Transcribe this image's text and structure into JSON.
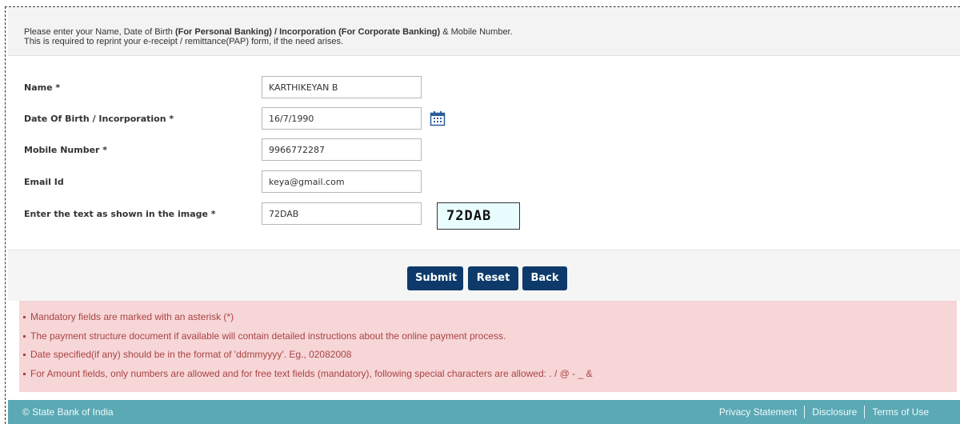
{
  "notice": {
    "line1_prefix": "Please enter your Name, Date of Birth ",
    "line1_bold": "(For Personal Banking) / Incorporation (For Corporate Banking)",
    "line1_suffix": " & Mobile Number.",
    "line2": "This is required to reprint your e-receipt / remittance(PAP) form, if the need arises."
  },
  "form": {
    "name": {
      "label": "Name *",
      "value": "KARTHIKEYAN B"
    },
    "dob": {
      "label": "Date Of Birth / Incorporation *",
      "value": "16/7/1990"
    },
    "mobile": {
      "label": "Mobile Number *",
      "value": "9966772287"
    },
    "email": {
      "label": "Email Id",
      "value": "keya@gmail.com"
    },
    "captcha": {
      "label": "Enter the text as shown in the image *",
      "value": "72DAB",
      "image_text": "72DAB"
    }
  },
  "buttons": {
    "submit": "Submit",
    "reset": "Reset",
    "back": "Back"
  },
  "info": [
    "Mandatory fields are marked with an asterisk (*)",
    "The payment structure document if available will contain detailed instructions about the online payment process.",
    "Date specified(if any) should be in the format of 'ddmmyyyy'. Eg., 02082008",
    "For Amount fields, only numbers are allowed and for free text fields (mandatory), following special characters are allowed: . / @ - _ &"
  ],
  "footer": {
    "copyright": "© State Bank of India",
    "links": [
      "Privacy Statement",
      "Disclosure",
      "Terms of Use"
    ]
  },
  "colors": {
    "button_bg": "#0d3a6b",
    "info_bg": "#f7d6d8",
    "info_text": "#a94442",
    "footer_bg": "#5aa9b5",
    "captcha_bg": "#e8fefe"
  },
  "icons": {
    "calendar": "calendar-icon"
  }
}
